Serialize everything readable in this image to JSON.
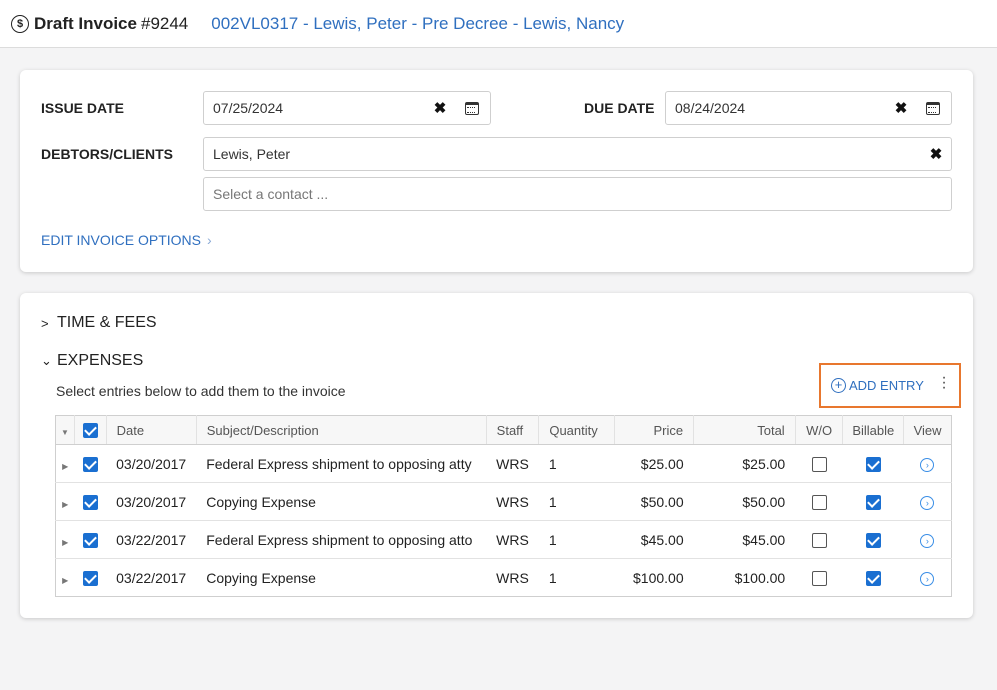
{
  "header": {
    "title": "Draft Invoice",
    "invoice_number": "#9244",
    "matter": "002VL0317 - Lewis, Peter - Pre Decree - Lewis, Nancy"
  },
  "invoice_form": {
    "issue_date_label": "ISSUE DATE",
    "issue_date_value": "07/25/2024",
    "due_date_label": "DUE DATE",
    "due_date_value": "08/24/2024",
    "debtors_label": "DEBTORS/CLIENTS",
    "debtor_value": "Lewis, Peter",
    "contact_placeholder": "Select a contact ...",
    "edit_options_label": "EDIT INVOICE OPTIONS"
  },
  "sections": {
    "time_fees": {
      "label": "TIME & FEES",
      "caret": ">"
    },
    "expenses": {
      "label": "EXPENSES",
      "caret": "⌄"
    }
  },
  "expenses": {
    "hint": "Select entries below to add them to the invoice",
    "add_entry_label": "ADD ENTRY",
    "columns": [
      "Date",
      "Subject/Description",
      "Staff",
      "Quantity",
      "Price",
      "Total",
      "W/O",
      "Billable",
      "View"
    ],
    "rows": [
      {
        "selected": true,
        "date": "03/20/2017",
        "description": "Federal Express shipment to opposing atty",
        "staff": "WRS",
        "quantity": "1",
        "price": "$25.00",
        "total": "$25.00",
        "write_off": false,
        "billable": true
      },
      {
        "selected": true,
        "date": "03/20/2017",
        "description": "Copying Expense",
        "staff": "WRS",
        "quantity": "1",
        "price": "$50.00",
        "total": "$50.00",
        "write_off": false,
        "billable": true
      },
      {
        "selected": true,
        "date": "03/22/2017",
        "description": "Federal Express shipment to opposing atto",
        "staff": "WRS",
        "quantity": "1",
        "price": "$45.00",
        "total": "$45.00",
        "write_off": false,
        "billable": true
      },
      {
        "selected": true,
        "date": "03/22/2017",
        "description": "Copying Expense",
        "staff": "WRS",
        "quantity": "1",
        "price": "$100.00",
        "total": "$100.00",
        "write_off": false,
        "billable": true
      }
    ]
  },
  "colors": {
    "link": "#2f6fbf",
    "checkbox": "#1a6fd1",
    "highlight": "#e8772e"
  }
}
